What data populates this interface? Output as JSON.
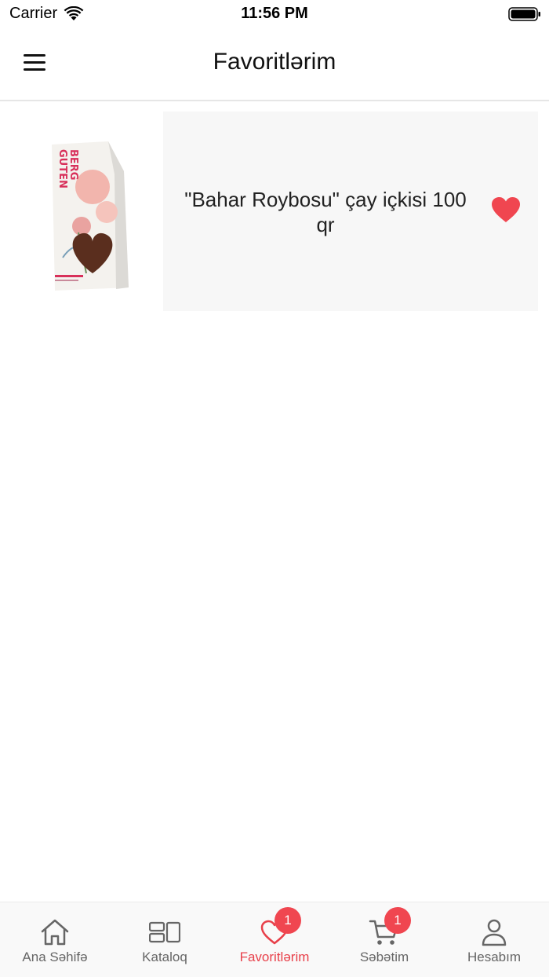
{
  "status_bar": {
    "carrier": "Carrier",
    "time": "11:56 PM"
  },
  "header": {
    "title": "Favoritlərim",
    "menu_icon": "hamburger-menu-icon"
  },
  "favorites": [
    {
      "name": "\"Bahar Roybosu\" çay içkisi 100 qr",
      "image": "tea-package-image",
      "favorite_icon": "heart-filled-icon",
      "heart_color": "#f04650"
    }
  ],
  "tab_bar": {
    "accent_color": "#e8404a",
    "tabs": [
      {
        "label": "Ana Səhifə",
        "icon": "home-icon",
        "active": false
      },
      {
        "label": "Kataloq",
        "icon": "catalog-icon",
        "active": false
      },
      {
        "label": "Favoritlərim",
        "icon": "heart-outline-icon",
        "active": true,
        "badge": "1"
      },
      {
        "label": "Səbətim",
        "icon": "cart-icon",
        "active": false,
        "badge": "1"
      },
      {
        "label": "Hesabım",
        "icon": "user-icon",
        "active": false
      }
    ]
  }
}
